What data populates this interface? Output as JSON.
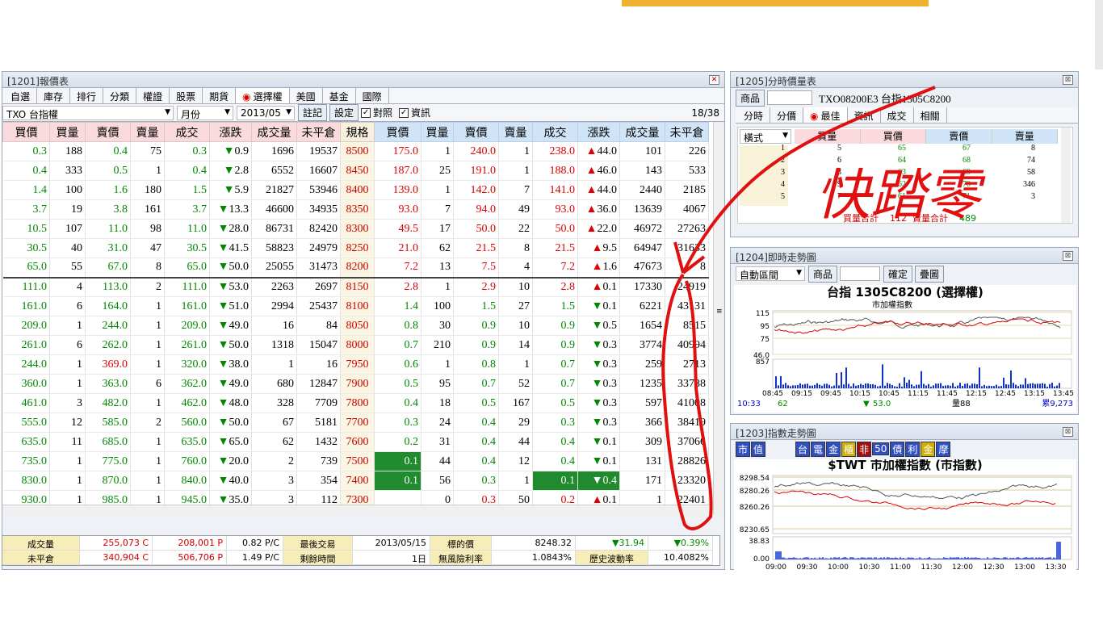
{
  "main_window": {
    "title": "[1201]報價表",
    "tabs": [
      "自選",
      "庫存",
      "排行",
      "分類",
      "權證",
      "股票",
      "期貨",
      "選擇權",
      "美國",
      "基金",
      "國際"
    ],
    "active_tab": "選擇權",
    "toolbar": {
      "product": "TXO  台指權",
      "period": "月份",
      "month": "2013/05",
      "note_btn": "註記",
      "settings_btn": "設定",
      "compare_label": "對照",
      "info_label": "資訊",
      "page": "18/38"
    },
    "headers": [
      "買價",
      "買量",
      "賣價",
      "賣量",
      "成交",
      "漲跌",
      "成交量",
      "未平倉",
      "規格",
      "買價",
      "買量",
      "賣價",
      "賣量",
      "成交",
      "漲跌",
      "成交量",
      "未平倉"
    ],
    "rows": [
      {
        "c": [
          "0.3",
          "188",
          "0.4",
          "75",
          "0.3",
          "0.9",
          "1696",
          "19537"
        ],
        "k": "8500",
        "p": [
          "175.0",
          "1",
          "240.0",
          "1",
          "238.0",
          "44.0",
          "101",
          "226"
        ],
        "cd": "dn",
        "pd": "up"
      },
      {
        "c": [
          "0.4",
          "333",
          "0.5",
          "1",
          "0.4",
          "2.8",
          "6552",
          "16607"
        ],
        "k": "8450",
        "p": [
          "187.0",
          "25",
          "191.0",
          "1",
          "188.0",
          "46.0",
          "143",
          "533"
        ],
        "cd": "dn",
        "pd": "up"
      },
      {
        "c": [
          "1.4",
          "100",
          "1.6",
          "180",
          "1.5",
          "5.9",
          "21827",
          "53946"
        ],
        "k": "8400",
        "p": [
          "139.0",
          "1",
          "142.0",
          "7",
          "141.0",
          "44.0",
          "2440",
          "2185"
        ],
        "cd": "dn",
        "pd": "up"
      },
      {
        "c": [
          "3.7",
          "19",
          "3.8",
          "161",
          "3.7",
          "13.3",
          "46600",
          "34935"
        ],
        "k": "8350",
        "p": [
          "93.0",
          "7",
          "94.0",
          "49",
          "93.0",
          "36.0",
          "13639",
          "4067"
        ],
        "cd": "dn",
        "pd": "up"
      },
      {
        "c": [
          "10.5",
          "107",
          "11.0",
          "98",
          "11.0",
          "28.0",
          "86731",
          "82420"
        ],
        "k": "8300",
        "p": [
          "49.5",
          "17",
          "50.0",
          "22",
          "50.0",
          "22.0",
          "46972",
          "27263"
        ],
        "cd": "dn",
        "pd": "up"
      },
      {
        "c": [
          "30.5",
          "40",
          "31.0",
          "47",
          "30.5",
          "41.5",
          "58823",
          "24979"
        ],
        "k": "8250",
        "p": [
          "21.0",
          "62",
          "21.5",
          "8",
          "21.5",
          "9.5",
          "64947",
          "31633"
        ],
        "cd": "dn",
        "pd": "up"
      },
      {
        "c": [
          "65.0",
          "55",
          "67.0",
          "8",
          "65.0",
          "50.0",
          "25055",
          "31473"
        ],
        "k": "8200",
        "p": [
          "7.2",
          "13",
          "7.5",
          "4",
          "7.2",
          "1.6",
          "47673",
          "8"
        ],
        "cd": "dn",
        "pd": "up"
      },
      {
        "c": [
          "111.0",
          "4",
          "113.0",
          "2",
          "111.0",
          "53.0",
          "2263",
          "2697"
        ],
        "k": "8150",
        "p": [
          "2.8",
          "1",
          "2.9",
          "10",
          "2.8",
          "0.1",
          "17330",
          "24919"
        ],
        "cd": "dn",
        "pd": "up"
      },
      {
        "c": [
          "161.0",
          "6",
          "164.0",
          "1",
          "161.0",
          "51.0",
          "2994",
          "25437"
        ],
        "k": "8100",
        "p": [
          "1.4",
          "100",
          "1.5",
          "27",
          "1.5",
          "0.1",
          "6221",
          "43131"
        ],
        "cd": "dn",
        "pd": "dn"
      },
      {
        "c": [
          "209.0",
          "1",
          "244.0",
          "1",
          "209.0",
          "49.0",
          "16",
          "84"
        ],
        "k": "8050",
        "p": [
          "0.8",
          "30",
          "0.9",
          "10",
          "0.9",
          "0.5",
          "1654",
          "8515"
        ],
        "cd": "dn",
        "pd": "dn"
      },
      {
        "c": [
          "261.0",
          "6",
          "262.0",
          "1",
          "261.0",
          "50.0",
          "1318",
          "15047"
        ],
        "k": "8000",
        "p": [
          "0.7",
          "210",
          "0.9",
          "14",
          "0.9",
          "0.3",
          "3774",
          "40994"
        ],
        "cd": "dn",
        "pd": "dn"
      },
      {
        "c": [
          "244.0",
          "1",
          "369.0",
          "1",
          "320.0",
          "38.0",
          "1",
          "16"
        ],
        "k": "7950",
        "p": [
          "0.6",
          "1",
          "0.8",
          "1",
          "0.7",
          "0.3",
          "259",
          "2713"
        ],
        "cd": "dn",
        "pd": "dn"
      },
      {
        "c": [
          "360.0",
          "1",
          "363.0",
          "6",
          "362.0",
          "49.0",
          "680",
          "12847"
        ],
        "k": "7900",
        "p": [
          "0.5",
          "95",
          "0.7",
          "52",
          "0.7",
          "0.3",
          "1235",
          "33788"
        ],
        "cd": "dn",
        "pd": "dn"
      },
      {
        "c": [
          "461.0",
          "3",
          "482.0",
          "1",
          "462.0",
          "48.0",
          "328",
          "7709"
        ],
        "k": "7800",
        "p": [
          "0.4",
          "18",
          "0.5",
          "167",
          "0.5",
          "0.3",
          "597",
          "41008"
        ],
        "cd": "dn",
        "pd": "dn"
      },
      {
        "c": [
          "555.0",
          "12",
          "585.0",
          "2",
          "560.0",
          "50.0",
          "67",
          "5181"
        ],
        "k": "7700",
        "p": [
          "0.3",
          "24",
          "0.4",
          "29",
          "0.3",
          "0.3",
          "366",
          "38419"
        ],
        "cd": "dn",
        "pd": "dn"
      },
      {
        "c": [
          "635.0",
          "11",
          "685.0",
          "1",
          "635.0",
          "65.0",
          "62",
          "1432"
        ],
        "k": "7600",
        "p": [
          "0.2",
          "31",
          "0.4",
          "44",
          "0.4",
          "0.1",
          "309",
          "37066"
        ],
        "cd": "dn",
        "pd": "dn"
      },
      {
        "c": [
          "735.0",
          "1",
          "775.0",
          "1",
          "760.0",
          "20.0",
          "2",
          "739"
        ],
        "k": "7500",
        "p": [
          "0.1",
          "44",
          "0.4",
          "12",
          "0.4",
          "0.1",
          "131",
          "28826"
        ],
        "cd": "dn",
        "pd": "dn"
      },
      {
        "c": [
          "830.0",
          "1",
          "870.0",
          "1",
          "840.0",
          "40.0",
          "3",
          "354"
        ],
        "k": "7400",
        "p": [
          "0.1",
          "56",
          "0.3",
          "1",
          "0.1",
          "0.4",
          "171",
          "23320"
        ],
        "cd": "dn",
        "pd": "dn"
      },
      {
        "c": [
          "930.0",
          "1",
          "985.0",
          "1",
          "945.0",
          "35.0",
          "3",
          "112"
        ],
        "k": "7300",
        "p": [
          "",
          "0",
          "0.3",
          "50",
          "0.2",
          "0.1",
          "1",
          "22401"
        ],
        "cd": "dn",
        "pd": "up"
      }
    ],
    "status": {
      "r1": [
        "成交量",
        "255,073 C",
        "208,001 P",
        "0.82 P/C",
        "最後交易",
        "2013/05/15",
        "標的價",
        "8248.32",
        "31.94",
        "0.39%"
      ],
      "r2": [
        "未平倉",
        "340,904 C",
        "506,706 P",
        "1.49 P/C",
        "剩餘時間",
        "1日",
        "無風險利率",
        "1.0843%",
        "歷史波動率",
        "10.4082%"
      ]
    }
  },
  "tick_window": {
    "title": "[1205]分時價量表",
    "product_btn": "商品",
    "product_text": "TXO08200E3 台指1305C8200",
    "tabs": [
      "分時",
      "分價",
      "最佳",
      "資訊",
      "成交",
      "相關"
    ],
    "mode": "橫式",
    "headers": [
      "買量",
      "買價",
      "賣價",
      "賣量"
    ],
    "rows": [
      {
        "n": "1",
        "bq": "5",
        "bp": "65",
        "sp": "67",
        "sq": "8"
      },
      {
        "n": "2",
        "bq": "6",
        "bp": "64",
        "sp": "68",
        "sq": "74"
      },
      {
        "n": "3",
        "bq": "3",
        "bp": "63",
        "sp": "69",
        "sq": "58"
      },
      {
        "n": "4",
        "bq": "9",
        "bp": "62",
        "sp": "70",
        "sq": "346"
      },
      {
        "n": "5",
        "bq": "7",
        "bp": "61",
        "sp": "71",
        "sq": "3"
      }
    ],
    "sum_buy_label": "買量合計",
    "sum_buy": "112",
    "sum_sell_label": "賣量合計",
    "sum_sell": "489",
    "handwriting": "快踏零"
  },
  "intraday_window": {
    "title": "[1204]即時走勢圖",
    "mode": "自動區間",
    "product_btn": "商品",
    "confirm_btn": "確定",
    "overlay_btn": "疊圖",
    "chart_title": "台指 1305C8200 (選擇權)",
    "overlay_label": "市加權指數",
    "y_labels": [
      "115",
      "95",
      "75",
      "46.0"
    ],
    "vol_max": "857",
    "x_labels": [
      "08:45",
      "09:15",
      "09:45",
      "10:15",
      "10:45",
      "11:15",
      "11:45",
      "12:15",
      "12:45",
      "13:15",
      "13:45"
    ],
    "time": "10:33",
    "price": "62",
    "change": "53.0",
    "volume_label": "量88",
    "cum_label": "累9,273"
  },
  "index_window": {
    "title": "[1203]指數走勢圖",
    "left_buttons": [
      "市",
      "值"
    ],
    "buttons": [
      "台",
      "電",
      "金",
      "櫃",
      "非",
      "50",
      "債",
      "利",
      "金",
      "摩"
    ],
    "chart_title": "$TWT 市加權指數 (市指數)",
    "y_labels": [
      "8298.54",
      "8280.26",
      "8260.26",
      "8230.65"
    ],
    "vol_labels": [
      "38.83",
      "0.00"
    ],
    "x_labels": [
      "09:00",
      "09:30",
      "10:00",
      "10:30",
      "11:00",
      "11:30",
      "12:00",
      "12:30",
      "13:00",
      "13:30"
    ]
  },
  "colors": {
    "up": "#dd0000",
    "down": "#008800",
    "highlight": "#1f8a2e",
    "annotation": "#e01010"
  }
}
